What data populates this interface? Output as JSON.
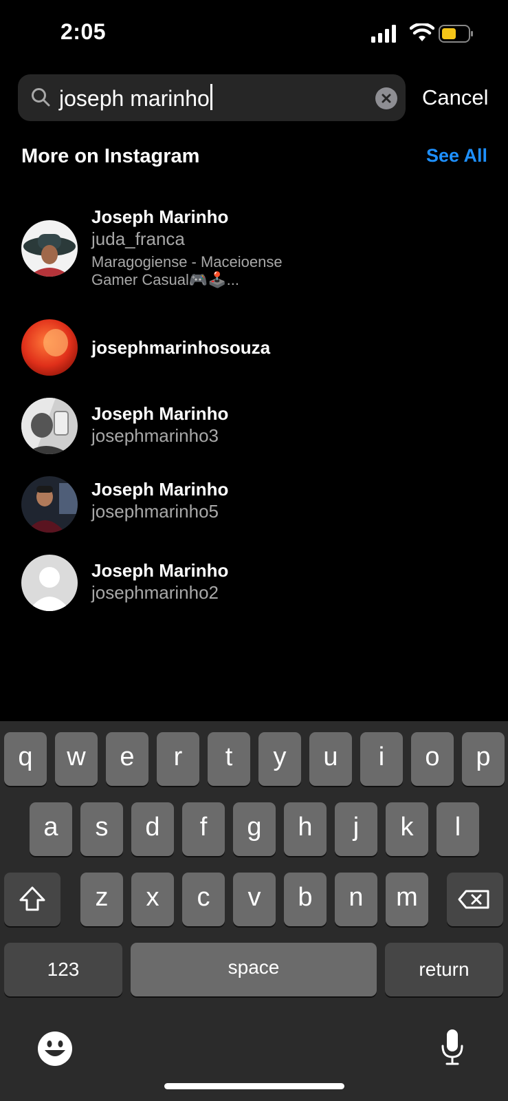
{
  "status_bar": {
    "time": "2:05",
    "battery_color": "#f5c518"
  },
  "search": {
    "query": "joseph marinho",
    "cancel_label": "Cancel"
  },
  "section": {
    "title": "More on Instagram",
    "see_all_label": "See All"
  },
  "results": [
    {
      "name": "Joseph Marinho",
      "username": "juda_franca",
      "bio_line1": "Maragogiense - Maceioense",
      "bio_line2": "Gamer Casual🎮🕹️...",
      "avatar": "photo-hat"
    },
    {
      "name": "",
      "username": "josephmarinhosouza",
      "avatar": "photo-red"
    },
    {
      "name": "Joseph Marinho",
      "username": "josephmarinho3",
      "avatar": "photo-mirror-selfie"
    },
    {
      "name": "Joseph Marinho",
      "username": "josephmarinho5",
      "avatar": "photo-portrait"
    },
    {
      "name": "Joseph Marinho",
      "username": "josephmarinho2",
      "avatar": "default-avatar"
    }
  ],
  "keyboard": {
    "row1": [
      "q",
      "w",
      "e",
      "r",
      "t",
      "y",
      "u",
      "i",
      "o",
      "p"
    ],
    "row2": [
      "a",
      "s",
      "d",
      "f",
      "g",
      "h",
      "j",
      "k",
      "l"
    ],
    "row3": [
      "z",
      "x",
      "c",
      "v",
      "b",
      "n",
      "m"
    ],
    "numbers_label": "123",
    "space_label": "space",
    "return_label": "return"
  }
}
